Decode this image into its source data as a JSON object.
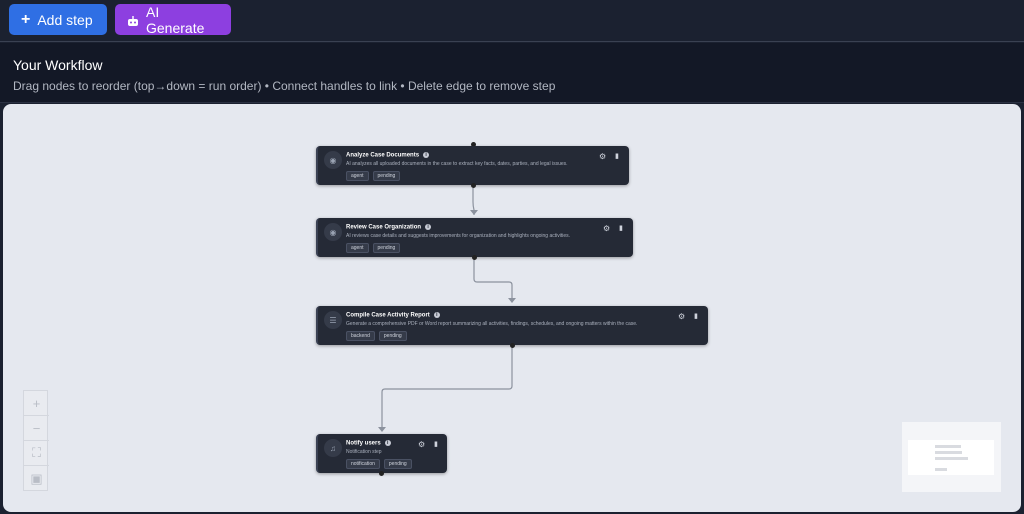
{
  "toolbar": {
    "add_step_label": "Add step",
    "ai_generate_label": "AI Generate"
  },
  "header": {
    "title": "Your Workflow",
    "subtitle": "Drag nodes to reorder (top→down = run order) • Connect handles to link • Delete edge to remove step"
  },
  "nodes": [
    {
      "name": "Analyze Case Documents",
      "description": "AI analyzes all uploaded documents in the case to extract key facts, dates, parties, and legal issues.",
      "tags": [
        "agent",
        "pending"
      ],
      "icon": "robot-icon"
    },
    {
      "name": "Review Case Organization",
      "description": "AI reviews case details and suggests improvements for organization and highlights ongoing activities.",
      "tags": [
        "agent",
        "pending"
      ],
      "icon": "robot-icon"
    },
    {
      "name": "Compile Case Activity Report",
      "description": "Generate a comprehensive PDF or Word report summarizing all activities, findings, schedules, and ongoing matters within the case.",
      "tags": [
        "backend",
        "pending"
      ],
      "icon": "list-icon"
    },
    {
      "name": "Notify users",
      "description": "Notification step",
      "tags": [
        "notification",
        "pending"
      ],
      "icon": "bell-icon"
    }
  ],
  "colors": {
    "primary": "#2f6fe4",
    "ai_accent": "#8d3fe0",
    "node_bg": "#252a36",
    "canvas_bg": "#e5e8ef"
  },
  "controls": [
    "zoom-in-icon",
    "zoom-out-icon",
    "fit-view-icon",
    "lock-icon"
  ]
}
